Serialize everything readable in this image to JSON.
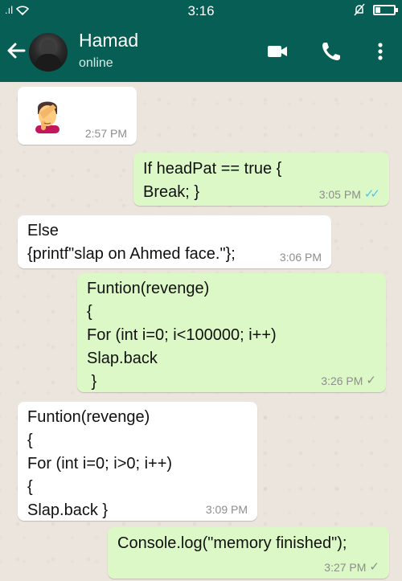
{
  "status_bar": {
    "signal": ".ıl",
    "time": "3:16",
    "icons": [
      "signal-icon",
      "wifi-icon",
      "notification-muted-icon",
      "battery-icon"
    ]
  },
  "header": {
    "contact_name": "Hamad",
    "contact_status": "online",
    "icons": [
      "back-arrow-icon",
      "video-call-icon",
      "voice-call-icon",
      "more-options-icon"
    ]
  },
  "colors": {
    "header": "#075e54",
    "outgoing_bubble": "#dcf8c6",
    "incoming_bubble": "#ffffff",
    "read_ticks": "#4fc3f7",
    "chat_background": "#ece5dd"
  },
  "messages": [
    {
      "direction": "in",
      "type": "emoji",
      "emoji": "facepalm-emoji",
      "time": "2:57 PM"
    },
    {
      "direction": "out",
      "text": "If headPat == true {\nBreak; }",
      "time": "3:05 PM",
      "status": "read",
      "ticks": "✓✓"
    },
    {
      "direction": "in",
      "text": "Else\n{printf\"slap on Ahmed face.\"};",
      "time": "3:06 PM"
    },
    {
      "direction": "out",
      "text": "Funtion(revenge)\n{\nFor (int i=0; i<100000; i++)\nSlap.back\n }",
      "time": "3:26 PM",
      "status": "sent",
      "ticks": "✓"
    },
    {
      "direction": "in",
      "text": "Funtion(revenge)\n{\nFor (int i=0; i>0; i++)\n{\nSlap.back }",
      "time": "3:09 PM"
    },
    {
      "direction": "out",
      "text": "Console.log(\"memory finished\");",
      "time": "3:27 PM",
      "status": "sent",
      "ticks": "✓"
    }
  ]
}
